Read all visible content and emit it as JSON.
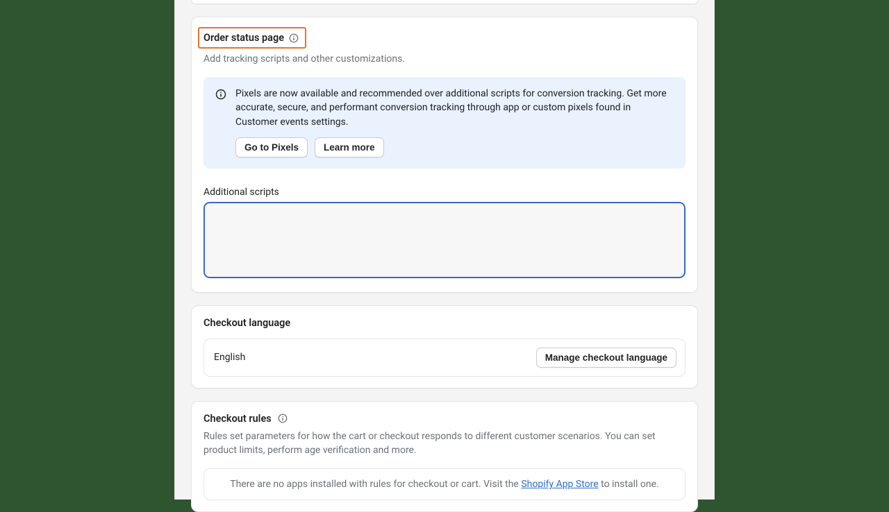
{
  "orderStatus": {
    "title": "Order status page",
    "subtitle": "Add tracking scripts and other customizations.",
    "banner": {
      "text": "Pixels are now available and recommended over additional scripts for conversion tracking. Get more accurate, secure, and performant conversion tracking through app or custom pixels found in Customer events settings.",
      "goToPixels": "Go to Pixels",
      "learnMore": "Learn more"
    },
    "additionalScriptsLabel": "Additional scripts",
    "additionalScriptsValue": ""
  },
  "checkoutLanguage": {
    "title": "Checkout language",
    "current": "English",
    "manageBtn": "Manage checkout language"
  },
  "checkoutRules": {
    "title": "Checkout rules",
    "desc": "Rules set parameters for how the cart or checkout responds to different customer scenarios. You can set product limits, perform age verification and more.",
    "notePrefix": "There are no apps installed with rules for checkout or cart. Visit the ",
    "noteLink": "Shopify App Store",
    "noteSuffix": " to install one."
  }
}
